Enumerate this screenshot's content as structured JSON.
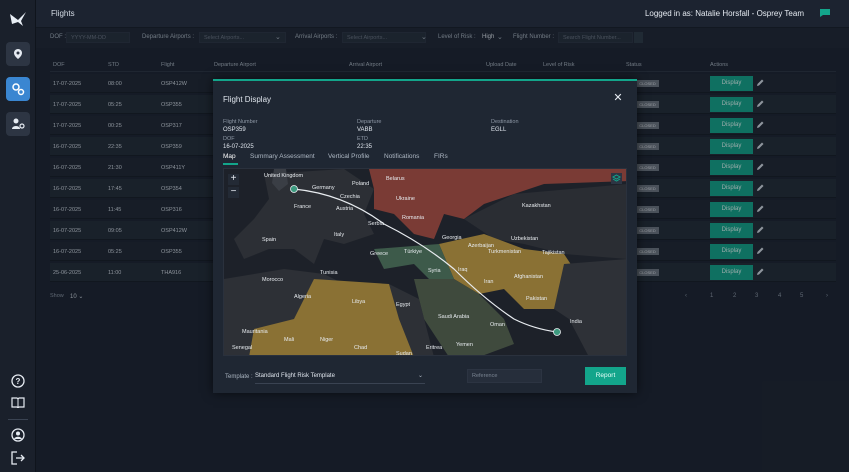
{
  "app": {
    "page_title": "Flights",
    "logged_in": "Logged in as: Natalie Horsfall - Osprey Team"
  },
  "filters": {
    "dof_label": "DOF :",
    "dof_placeholder": "YYYY-MM-DD",
    "dep_label": "Departure Airports :",
    "dep_placeholder": "Select Airports...",
    "arr_label": "Arrival Airports :",
    "arr_placeholder": "Select Airports...",
    "risk_label": "Level of Risk :",
    "risk_value": "High",
    "flightnum_label": "Flight Number :",
    "flightnum_placeholder": "Search Flight Number..."
  },
  "table": {
    "headers": [
      "DOF",
      "STD",
      "Flight",
      "Departure Airport",
      "Arrival Airport",
      "Upload Date",
      "Level of Risk",
      "Status",
      "Actions"
    ],
    "display_label": "Display",
    "rows": [
      {
        "dof": "17-07-2025",
        "std": "08:00",
        "flight": "OSP412W",
        "status": "CLOSED"
      },
      {
        "dof": "17-07-2025",
        "std": "05:25",
        "flight": "OSP355",
        "status": "CLOSED"
      },
      {
        "dof": "17-07-2025",
        "std": "00:25",
        "flight": "OSP317",
        "status": "CLOSED"
      },
      {
        "dof": "16-07-2025",
        "std": "22:35",
        "flight": "OSP359",
        "status": "CLOSED"
      },
      {
        "dof": "16-07-2025",
        "std": "21:30",
        "flight": "OSP411Y",
        "status": "CLOSED"
      },
      {
        "dof": "16-07-2025",
        "std": "17:45",
        "flight": "OSP354",
        "status": "CLOSED"
      },
      {
        "dof": "16-07-2025",
        "std": "11:45",
        "flight": "OSP316",
        "status": "CLOSED"
      },
      {
        "dof": "16-07-2025",
        "std": "09:05",
        "flight": "OSP412W",
        "status": "CLOSED"
      },
      {
        "dof": "16-07-2025",
        "std": "05:25",
        "flight": "OSP355",
        "status": "CLOSED"
      },
      {
        "dof": "25-06-2025",
        "std": "11:00",
        "flight": "THA916",
        "status": "CLOSED"
      }
    ],
    "show_label": "Show",
    "show_value": "10",
    "pages": [
      "‹",
      "1",
      "2",
      "3",
      "4",
      "5",
      "›"
    ]
  },
  "modal": {
    "title": "Flight Display",
    "close": "✕",
    "flight_number_label": "Flight Number",
    "flight_number": "OSP359",
    "departure_label": "Departure",
    "departure": "VABB",
    "destination_label": "Destination",
    "destination": "EGLL",
    "dof_label": "DOF",
    "dof": "16-07-2025",
    "etd_label": "ETD",
    "etd": "22:35",
    "tabs": [
      "Map",
      "Summary Assessment",
      "Vertical Profile",
      "Notifications",
      "FIRs"
    ],
    "zoom_in": "+",
    "zoom_out": "−",
    "template_label": "Template :",
    "template_value": "Standard Flight Risk Template",
    "reference_placeholder": "Reference",
    "report_label": "Report"
  },
  "map_labels": [
    "United Kingdom",
    "Germany",
    "Poland",
    "Belarus",
    "Ukraine",
    "France",
    "Czechia",
    "Austria",
    "Serbia",
    "Romania",
    "Italy",
    "Spain",
    "Kazakhstan",
    "Uzbekistan",
    "Georgia",
    "Azerbaijan",
    "Turkmenistan",
    "Türkiye",
    "Greece",
    "Tajikistan",
    "Tunisia",
    "Morocco",
    "Syria",
    "Iraq",
    "Iran",
    "Afghanistan",
    "Algeria",
    "Libya",
    "Egypt",
    "Pakistan",
    "Saudi Arabia",
    "Oman",
    "India",
    "Mauritania",
    "Mali",
    "Niger",
    "Chad",
    "Sudan",
    "Eritrea",
    "Yemen",
    "Senegal"
  ],
  "colors": {
    "accent": "#13a58b",
    "sidebar_active": "#3a86d1",
    "risk_red": "#7a3b35",
    "risk_amber": "#8a7134",
    "risk_green": "#3d5a4a"
  }
}
